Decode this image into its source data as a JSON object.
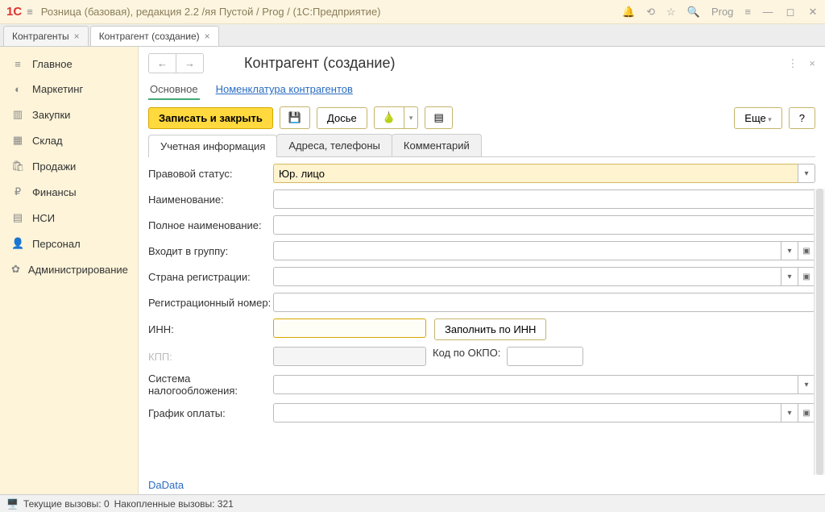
{
  "titlebar": {
    "logo": "1С",
    "title": "Розница (базовая), редакция 2.2 /яя Пустой / Prog /  (1С:Предприятие)",
    "prog_label": "Prog"
  },
  "tabs": [
    {
      "label": "Контрагенты",
      "active": false
    },
    {
      "label": "Контрагент (создание)",
      "active": true
    }
  ],
  "sidebar": {
    "items": [
      {
        "icon": "≡",
        "label": "Главное"
      },
      {
        "icon": "◐",
        "label": "Маркетинг"
      },
      {
        "icon": "▥",
        "label": "Закупки"
      },
      {
        "icon": "▦",
        "label": "Склад"
      },
      {
        "icon": "🛍",
        "label": "Продажи"
      },
      {
        "icon": "₽",
        "label": "Финансы"
      },
      {
        "icon": "▤",
        "label": "НСИ"
      },
      {
        "icon": "👤",
        "label": "Персонал"
      },
      {
        "icon": "✿",
        "label": "Администрирование"
      }
    ]
  },
  "page": {
    "title": "Контрагент (создание)",
    "subtabs": {
      "main": "Основное",
      "nomenclature": "Номенклатура контрагентов"
    },
    "toolbar": {
      "save_close": "Записать и закрыть",
      "dossier": "Досье",
      "more": "Еще",
      "help": "?"
    },
    "form_tabs": [
      "Учетная информация",
      "Адреса, телефоны",
      "Комментарий"
    ],
    "fields": {
      "legal_status": {
        "label": "Правовой статус:",
        "value": "Юр. лицо"
      },
      "name": {
        "label": "Наименование:",
        "value": ""
      },
      "full_name": {
        "label": "Полное наименование:",
        "value": ""
      },
      "group": {
        "label": "Входит в группу:",
        "value": ""
      },
      "country": {
        "label": "Страна регистрации:",
        "value": ""
      },
      "reg_number": {
        "label": "Регистрационный номер:",
        "value": ""
      },
      "inn": {
        "label": "ИНН:",
        "value": "",
        "fill_btn": "Заполнить по ИНН"
      },
      "kpp": {
        "label": "КПП:",
        "value": "",
        "okpo_label": "Код по ОКПО:",
        "okpo_value": ""
      },
      "tax_system": {
        "label": "Система налогообложения:",
        "value": ""
      },
      "payment_schedule": {
        "label": "График оплаты:",
        "value": ""
      }
    },
    "footer_link": "DaData"
  },
  "statusbar": {
    "current": "Текущие вызовы: 0",
    "accumulated": "Накопленные вызовы: 321"
  }
}
